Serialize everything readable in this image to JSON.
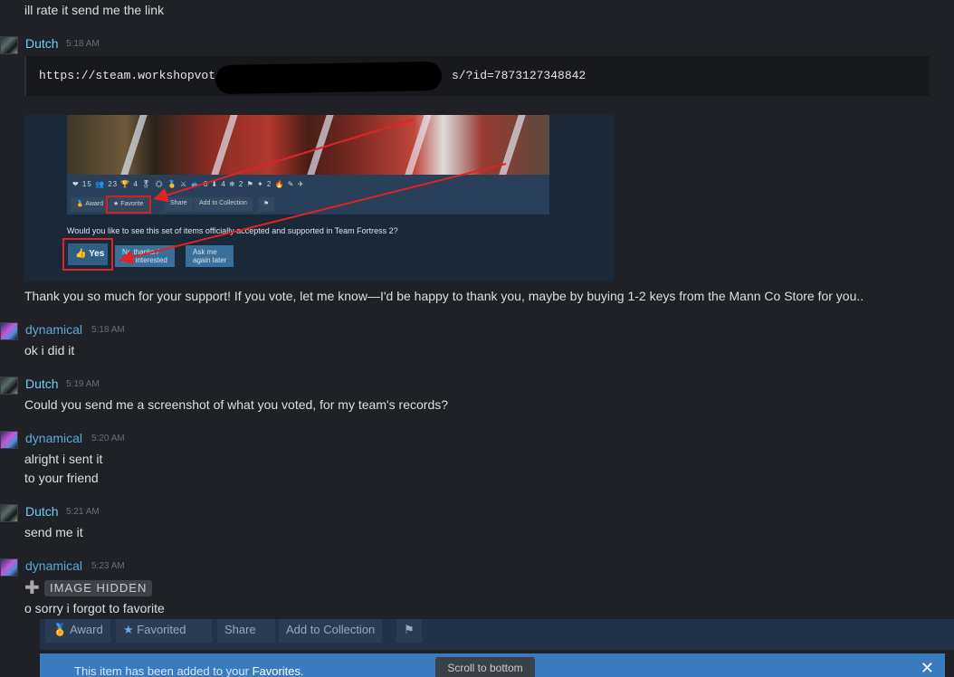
{
  "messages": [
    {
      "text": "ill rate it send me the link"
    },
    {
      "author": "Dutch",
      "time": "5:18 AM",
      "code": "https://steam.workshopvote",
      "code_tail": "s/?id=7873127348842",
      "embed": {
        "tags": "❤ 15 👥 23 🏆 4 🎖 ☀ 🥇 ⚔ 🐟 6 ⬇ 4 ❄ 2 ⚑ ✦ 2 🔥 ✎ ✈",
        "buttons": [
          "Award",
          "Favorite",
          "Share",
          "Add to Collection"
        ],
        "question": "Would you like to see this set of items officially accepted and supported in Team Fortress 2?",
        "vote_yes": "Yes",
        "vote_no": [
          "No thanks /",
          "Not interested"
        ],
        "vote_later": [
          "Ask me",
          "again later"
        ]
      },
      "text": "Thank you so much for your support! If you vote, let me know—I'd be happy to thank you, maybe by buying 1-2 keys from the Mann Co Store for you.."
    },
    {
      "author": "dynamical",
      "time": "5:18 AM",
      "text": "ok i did it"
    },
    {
      "author": "Dutch",
      "time": "5:19 AM",
      "text": "Could you send me a screenshot of what you voted, for my team's records?"
    },
    {
      "author": "dynamical",
      "time": "5:20 AM",
      "lines": [
        "alright i sent it",
        "to your friend"
      ]
    },
    {
      "author": "Dutch",
      "time": "5:21 AM",
      "text": "send me it"
    },
    {
      "author": "dynamical",
      "time": "5:23 AM",
      "hidden_label": "IMAGE HIDDEN",
      "text": "o sorry i forgot to favorite"
    }
  ],
  "bottom_buttons": [
    "Award",
    "Favorited",
    "Share",
    "Add to Collection"
  ],
  "notice": {
    "prefix": "This item has been added to your ",
    "highlight": "Favorites",
    "suffix": "."
  },
  "scroll_to_bottom": "Scroll to bottom",
  "colors": {
    "background": "#1f2126",
    "dutch_name": "#6dcff6",
    "dynamical_name": "#5aa9d6",
    "highlight_red": "#e02323"
  }
}
